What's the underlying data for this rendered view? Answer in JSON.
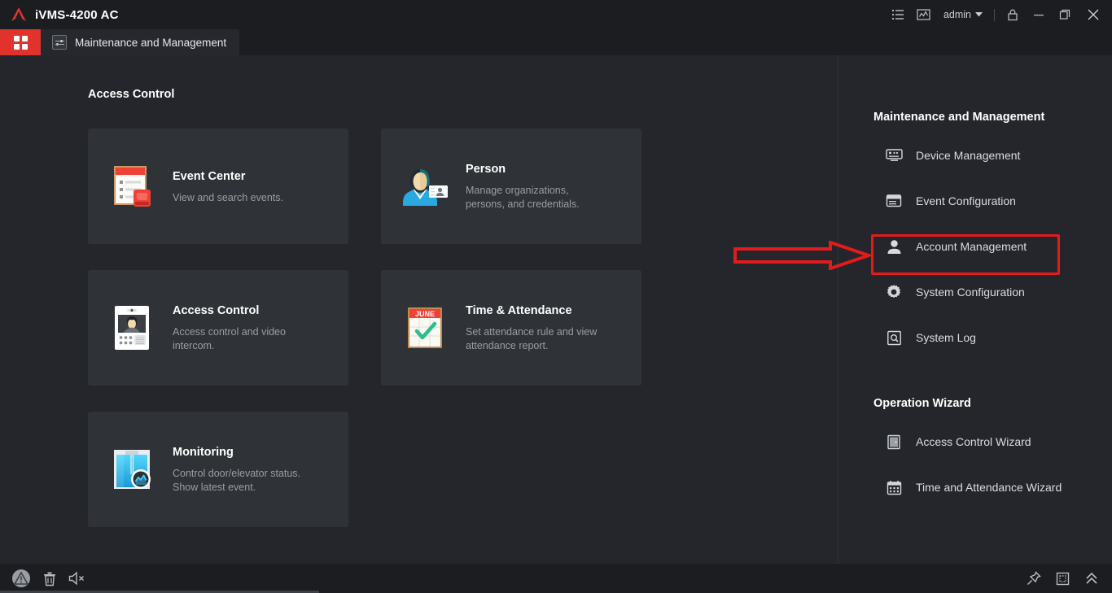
{
  "titlebar": {
    "app_title": "iVMS-4200 AC",
    "logo_icon": "hik-triangle-logo",
    "right_icons": [
      {
        "name": "list-view-icon",
        "label": "list"
      },
      {
        "name": "statistics-icon",
        "label": "statistics"
      }
    ],
    "user": "admin",
    "user_caret_icon": "chevron-down-icon",
    "lock_icon": "lock-icon",
    "minimize_icon": "minimize-icon",
    "maximize_icon": "maximize-icon",
    "close_icon": "close-icon"
  },
  "tabbar": {
    "home_icon": "grid-menu-icon",
    "active_tab": {
      "label": "Maintenance and Management",
      "icon": "settings-sliders-icon"
    }
  },
  "main": {
    "section_title": "Access Control",
    "cards": [
      {
        "title": "Event Center",
        "desc": "View and search events.",
        "icon": "event-list-alarm-icon"
      },
      {
        "title": "Person",
        "desc": "Manage organizations, persons, and credentials.",
        "icon": "person-id-card-icon"
      },
      {
        "title": "Access Control",
        "desc": "Access control and video intercom.",
        "icon": "door-station-icon"
      },
      {
        "title": "Time & Attendance",
        "desc": "Set attendance rule and view attendance report.",
        "icon": "calendar-check-icon",
        "calendar_month": "JUNE"
      },
      {
        "title": "Monitoring",
        "desc": "Control door/elevator status. Show latest event.",
        "icon": "door-monitor-icon"
      }
    ]
  },
  "right_panel": {
    "section_1_title": "Maintenance and Management",
    "section_1_items": [
      {
        "label": "Device Management",
        "icon": "device-icon"
      },
      {
        "label": "Event Configuration",
        "icon": "event-config-icon"
      },
      {
        "label": "Account Management",
        "icon": "user-account-icon",
        "highlighted": true
      },
      {
        "label": "System Configuration",
        "icon": "gear-icon"
      },
      {
        "label": "System Log",
        "icon": "log-search-icon"
      }
    ],
    "section_2_title": "Operation Wizard",
    "section_2_items": [
      {
        "label": "Access Control Wizard",
        "icon": "door-wizard-icon"
      },
      {
        "label": "Time and Attendance Wizard",
        "icon": "calendar-wizard-icon"
      }
    ]
  },
  "annotation": {
    "highlight_color": "#e21b1b",
    "arrow_icon": "right-arrow-annotation",
    "target": "Account Management"
  },
  "statusbar": {
    "left_icons": [
      {
        "name": "alarm-warning-icon"
      },
      {
        "name": "trash-icon"
      },
      {
        "name": "mute-speaker-icon"
      }
    ],
    "right_icons": [
      {
        "name": "pin-icon"
      },
      {
        "name": "panel-icon"
      },
      {
        "name": "chevrons-up-icon"
      }
    ]
  },
  "colors": {
    "accent_red": "#e1332e",
    "window_bg": "#24262b",
    "card_bg": "#2f3237",
    "bar_bg": "#1b1d21"
  }
}
